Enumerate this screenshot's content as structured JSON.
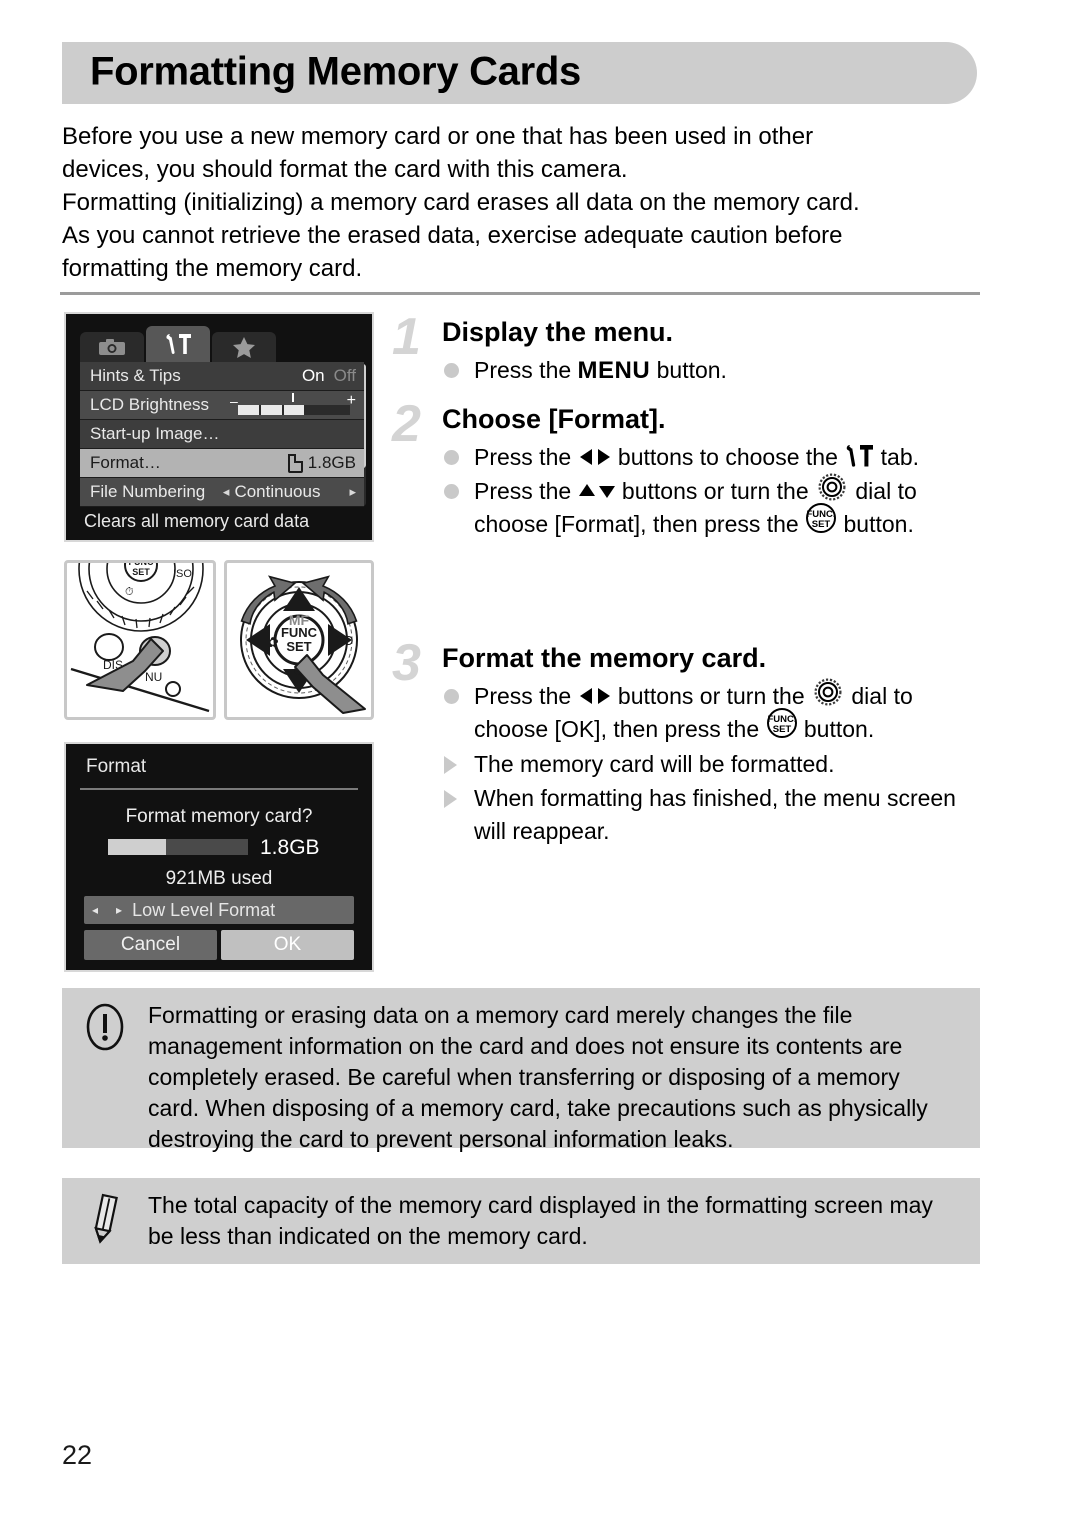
{
  "header": {
    "title": "Formatting Memory Cards"
  },
  "intro": {
    "line1": "Before you use a new memory card or one that has been used in other",
    "line2": "devices, you should format the card with this camera.",
    "line3": "Formatting (initializing) a memory card erases all data on the memory card.",
    "line4": "As you cannot retrieve the erased data, exercise adequate caution before",
    "line5": "formatting the memory card."
  },
  "menu_screen": {
    "tabs": [
      {
        "icon": "camera-icon",
        "active": false
      },
      {
        "icon": "wrench-hammer-icon",
        "active": true
      },
      {
        "icon": "star-icon",
        "active": false
      }
    ],
    "rows": [
      {
        "label": "Hints & Tips",
        "value_on": "On",
        "value_off": "Off"
      },
      {
        "label": "LCD Brightness",
        "minus": "–",
        "plus": "+"
      },
      {
        "label": "Start-up Image…",
        "value": ""
      },
      {
        "label": "Format…",
        "value": "1.8GB",
        "selected": true
      },
      {
        "label": "File Numbering",
        "value": "Continuous",
        "left_arrow": "◂",
        "right_arrow": "▸"
      }
    ],
    "hint": "Clears all memory card data"
  },
  "format_dialog": {
    "title": "Format",
    "question": "Format memory card?",
    "capacity": "1.8GB",
    "used": "921MB used",
    "low_level_format": "Low Level Format",
    "left_arrow": "◂",
    "right_arrow": "▸",
    "cancel": "Cancel",
    "ok": "OK"
  },
  "steps": [
    {
      "number": "1",
      "heading": "Display the menu.",
      "bullets": [
        {
          "type": "dot",
          "pre": "Press the ",
          "mid_icon": "menu-button-word",
          "mid_text": "MENU",
          "post": " button."
        }
      ]
    },
    {
      "number": "2",
      "heading": "Choose [Format].",
      "bullets": [
        {
          "type": "dot",
          "t1": "Press the ",
          "i1": "left-right-buttons-icon",
          "t2": " buttons to choose the ",
          "i2": "wrench-hammer-icon",
          "t3": " tab."
        },
        {
          "type": "dot",
          "t1": "Press the ",
          "i1": "up-down-buttons-icon",
          "t2": " buttons or turn the ",
          "i2": "control-dial-icon",
          "t3": " dial to choose [Format], then press the ",
          "i3": "func-set-icon",
          "t4": " button."
        }
      ]
    },
    {
      "number": "3",
      "heading": "Format the memory card.",
      "bullets": [
        {
          "type": "dot",
          "t1": "Press the ",
          "i1": "left-right-buttons-icon",
          "t2": " buttons or turn the ",
          "i2": "control-dial-icon",
          "t3": " dial to choose [OK], then press the ",
          "i3": "func-set-icon",
          "t4": " button."
        },
        {
          "type": "tri",
          "t1": "The memory card will be formatted."
        },
        {
          "type": "tri",
          "t1": "When formatting has finished, the menu screen will reappear."
        }
      ]
    }
  ],
  "warning": {
    "icon": "exclamation-circle-icon",
    "text": "Formatting or erasing data on a memory card merely changes the file management information on the card and does not ensure its contents are completely erased. Be careful when transferring or disposing of a memory card. When disposing of a memory card, take precautions such as physically destroying the card to prevent personal information leaks."
  },
  "note": {
    "icon": "pencil-icon",
    "text": "The total capacity of the memory card displayed in the formatting screen may be less than indicated on the memory card."
  },
  "photos": [
    {
      "name": "camera-menu-button-photo",
      "labels": [
        "DISP.",
        "MENU"
      ]
    },
    {
      "name": "camera-control-dial-photo",
      "labels": [
        "MF",
        "ISO",
        "FUNC. SET"
      ]
    }
  ],
  "page_number": "22",
  "colors": {
    "header_band": "#cdcdcd",
    "callout_bg": "#cfcfcf",
    "step_number": "#d4d4d4",
    "bullet": "#c9c9c9",
    "lcd_bg": "#111111",
    "selected_row": "#b3b3b3"
  }
}
